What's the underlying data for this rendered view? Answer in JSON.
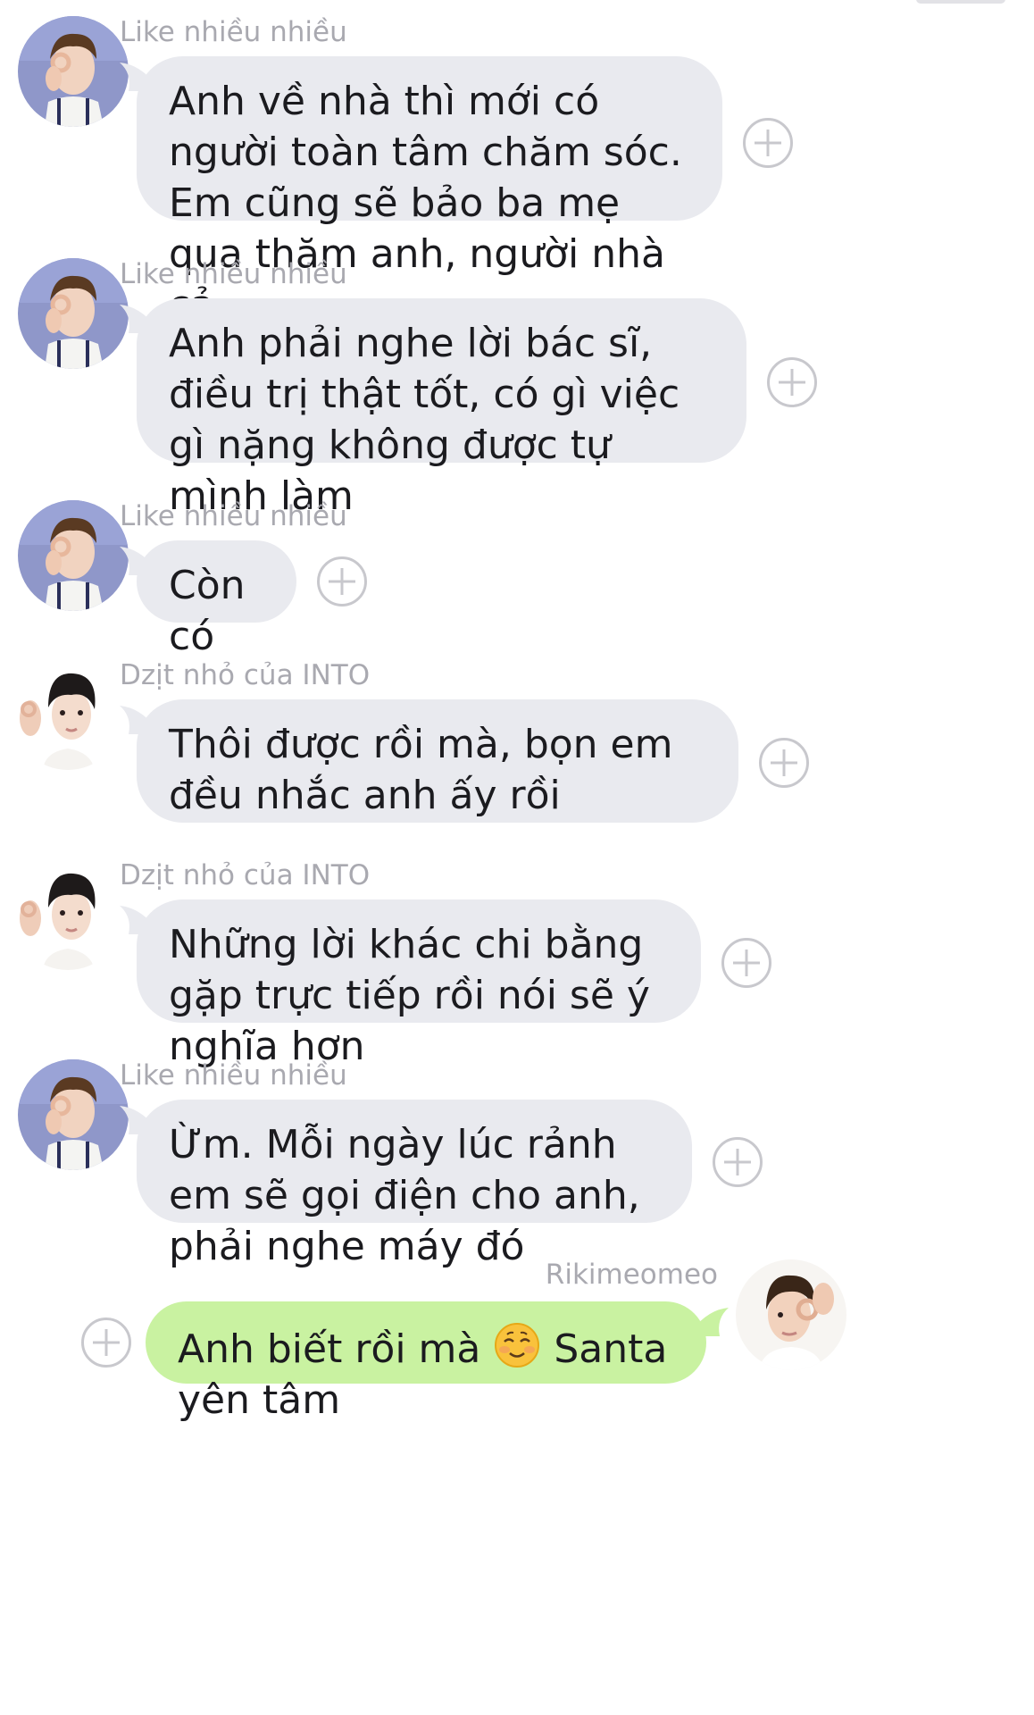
{
  "colors": {
    "incoming_bubble": "#e9eaef",
    "outgoing_bubble": "#c9f2a1",
    "sender_name": "#a9a9b0",
    "plus_icon": "#c8c8cd"
  },
  "messages": [
    {
      "sender": "Like nhiều nhiều",
      "direction": "incoming",
      "avatar": "avatar-like-nhieu-nhieu",
      "text": "Anh về nhà thì mới có người toàn tâm chăm sóc. Em cũng sẽ bảo ba mẹ qua thăm anh, người nhà cả"
    },
    {
      "sender": "Like nhiều nhiều",
      "direction": "incoming",
      "avatar": "avatar-like-nhieu-nhieu",
      "text": "Anh phải nghe lời bác sĩ, điều trị thật tốt, có gì việc gì nặng không được tự mình làm"
    },
    {
      "sender": "Like nhiều nhiều",
      "direction": "incoming",
      "avatar": "avatar-like-nhieu-nhieu",
      "text": "Còn có"
    },
    {
      "sender": "Dzịt nhỏ của INTO",
      "direction": "incoming",
      "avatar": "avatar-dzit-nho",
      "text": "Thôi được rồi mà, bọn em đều nhắc anh ấy rồi"
    },
    {
      "sender": "Dzịt nhỏ của INTO",
      "direction": "incoming",
      "avatar": "avatar-dzit-nho",
      "text": "Những lời khác chi bằng gặp trực tiếp rồi nói sẽ ý nghĩa hơn"
    },
    {
      "sender": "Like nhiều nhiều",
      "direction": "incoming",
      "avatar": "avatar-like-nhieu-nhieu",
      "text": "Ừm. Mỗi ngày lúc rảnh em sẽ gọi điện cho anh, phải nghe máy đó"
    },
    {
      "sender": "Rikimeomeo",
      "direction": "outgoing",
      "avatar": "avatar-rikimeomeo",
      "text_before_emoji": "Anh biết rồi mà",
      "emoji": "smiling-face-icon",
      "text_after_emoji": "Santa yên tâm"
    }
  ]
}
